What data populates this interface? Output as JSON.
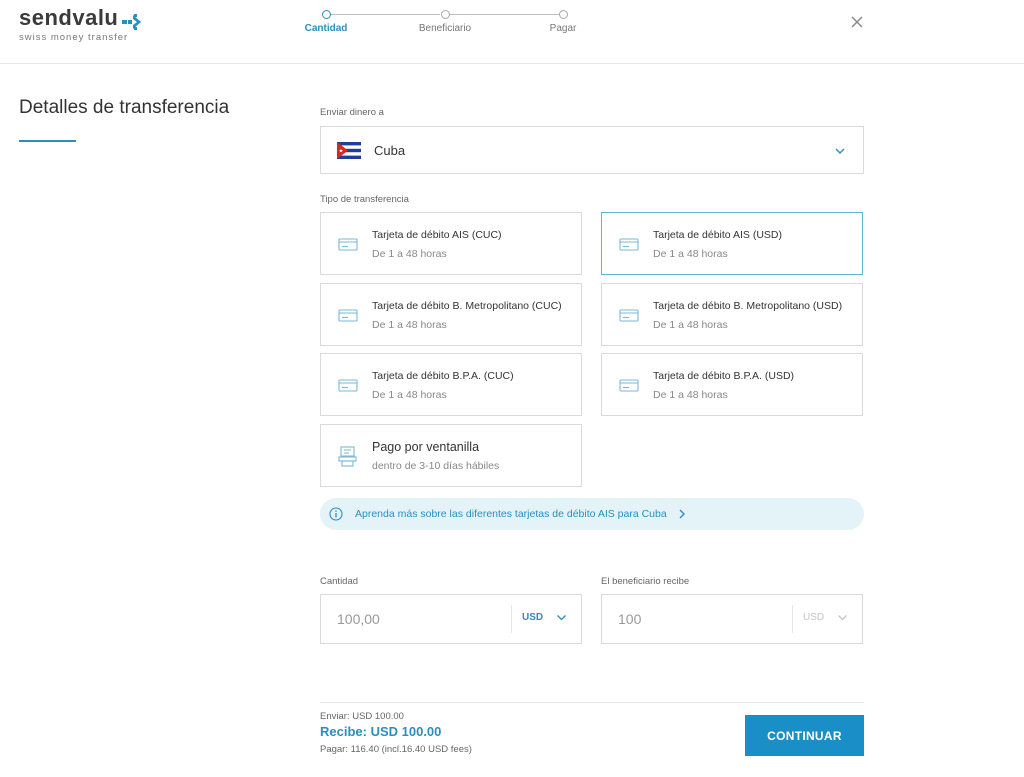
{
  "brand": {
    "name": "sendvalu",
    "tagline": "swiss money transfer"
  },
  "stepper": {
    "steps": [
      {
        "label": "Cantidad",
        "active": true
      },
      {
        "label": "Beneficiario",
        "active": false
      },
      {
        "label": "Pagar",
        "active": false
      }
    ]
  },
  "page_title": "Detalles de transferencia",
  "destination": {
    "label": "Enviar dinero a",
    "country": "Cuba"
  },
  "transfer_type": {
    "label": "Tipo de transferencia",
    "options": [
      {
        "name": "Tarjeta de débito AIS (CUC)",
        "time": "De 1 a 48 horas",
        "selected": false,
        "icon": "card-icon"
      },
      {
        "name": "Tarjeta de débito AIS (USD)",
        "time": "De 1 a 48 horas",
        "selected": true,
        "icon": "card-icon"
      },
      {
        "name": "Tarjeta de débito B. Metropolitano (CUC)",
        "time": "De 1 a 48 horas",
        "selected": false,
        "icon": "card-icon"
      },
      {
        "name": "Tarjeta de débito B. Metropolitano (USD)",
        "time": "De 1 a 48 horas",
        "selected": false,
        "icon": "card-icon"
      },
      {
        "name": "Tarjeta de débito B.P.A. (CUC)",
        "time": "De 1 a 48 horas",
        "selected": false,
        "icon": "card-icon"
      },
      {
        "name": "Tarjeta de débito B.P.A. (USD)",
        "time": "De 1 a 48 horas",
        "selected": false,
        "icon": "card-icon"
      },
      {
        "name": "Pago por ventanilla",
        "time": "dentro de 3-10 días hábiles",
        "selected": false,
        "icon": "cash-counter-icon"
      }
    ]
  },
  "info_banner": {
    "text": "Aprenda más sobre las diferentes tarjetas de débito AIS para Cuba"
  },
  "amount": {
    "label": "Cantidad",
    "value": "100,00",
    "currency": "USD"
  },
  "recipient_amount": {
    "label": "El beneficiario recibe",
    "value": "100",
    "currency": "USD"
  },
  "summary": {
    "send": "Enviar: USD 100.00",
    "receive": "Recibe: USD 100.00",
    "pay": "Pagar: 116.40 (incl.16.40 USD fees)"
  },
  "continue_label": "CONTINUAR",
  "colors": {
    "accent": "#2a8fbd",
    "button": "#1a8fc7",
    "banner_bg": "#e4f3f8",
    "selected_border": "#5eb8d0"
  }
}
